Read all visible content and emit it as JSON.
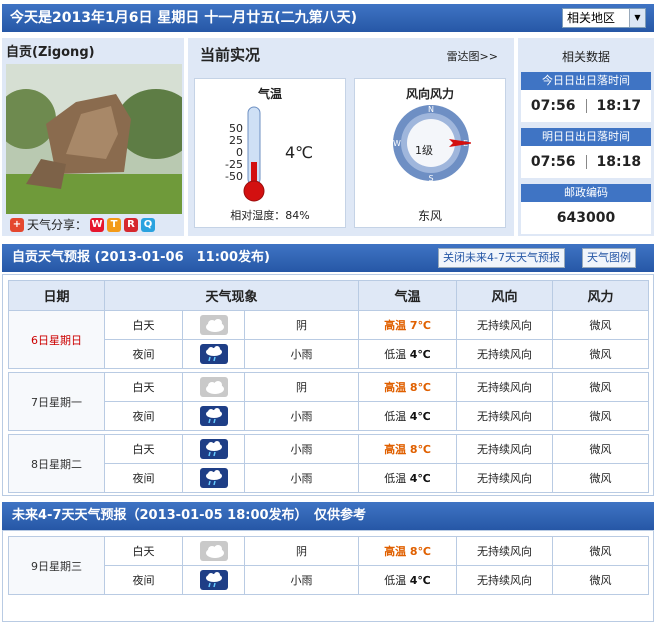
{
  "header": {
    "title": "今天是2013年1月6日 星期日 十一月廿五(二九第八天)",
    "region_select": "相关地区"
  },
  "city": {
    "name": "自贡(Zigong)",
    "share_label": "天气分享："
  },
  "current": {
    "title": "当前实况",
    "radar_link": "雷达图>>",
    "temp_box_title": "气温",
    "scale": [
      "50",
      "25",
      "0",
      "-25",
      "-50"
    ],
    "temp": "4℃",
    "temp_level_pct": 27,
    "humidity": "相对湿度：84%",
    "wind_box_title": "风向风力",
    "wind_level": "1级",
    "wind_dir": "东风",
    "compass": {
      "n": "N",
      "e": "E",
      "s": "S",
      "w": "W"
    }
  },
  "related": {
    "title": "相关数据",
    "today_label": "今日日出日落时间",
    "today_sunrise": "07:56",
    "today_sunset": "18:17",
    "tomorrow_label": "明日日出日落时间",
    "tomorrow_sunrise": "07:56",
    "tomorrow_sunset": "18:18",
    "postal_label": "邮政编码",
    "postal_code": "643000"
  },
  "forecast": {
    "title": "自贡天气预报 (2013-01-06　11:00发布)",
    "close_btn": "关闭未来4-7天天气预报",
    "legend_btn": "天气图例",
    "headers": [
      "日期",
      "天气现象",
      "气温",
      "风向",
      "风力"
    ],
    "days": [
      {
        "date": "6日星期日",
        "rows": [
          {
            "period": "白天",
            "icon": "cloudy-icon",
            "weather": "阴",
            "temp_label": "高温",
            "temp": "7℃",
            "wind_dir": "无持续风向",
            "wind_force": "微风"
          },
          {
            "period": "夜间",
            "icon": "light-rain-icon",
            "weather": "小雨",
            "temp_label": "低温",
            "temp": "4℃",
            "wind_dir": "无持续风向",
            "wind_force": "微风"
          }
        ]
      },
      {
        "date": "7日星期一",
        "rows": [
          {
            "period": "白天",
            "icon": "cloudy-icon",
            "weather": "阴",
            "temp_label": "高温",
            "temp": "8℃",
            "wind_dir": "无持续风向",
            "wind_force": "微风"
          },
          {
            "period": "夜间",
            "icon": "light-rain-icon",
            "weather": "小雨",
            "temp_label": "低温",
            "temp": "4℃",
            "wind_dir": "无持续风向",
            "wind_force": "微风"
          }
        ]
      },
      {
        "date": "8日星期二",
        "rows": [
          {
            "period": "白天",
            "icon": "light-rain-icon",
            "weather": "小雨",
            "temp_label": "高温",
            "temp": "8℃",
            "wind_dir": "无持续风向",
            "wind_force": "微风"
          },
          {
            "period": "夜间",
            "icon": "light-rain-icon",
            "weather": "小雨",
            "temp_label": "低温",
            "temp": "4℃",
            "wind_dir": "无持续风向",
            "wind_force": "微风"
          }
        ]
      }
    ]
  },
  "future": {
    "title": "未来4-7天天气预报（2013-01-05 18:00发布）　仅供参考",
    "days": [
      {
        "date": "9日星期三",
        "rows": [
          {
            "period": "白天",
            "icon": "cloudy-icon",
            "weather": "阴",
            "temp_label": "高温",
            "temp": "8℃",
            "wind_dir": "无持续风向",
            "wind_force": "微风"
          },
          {
            "period": "夜间",
            "icon": "light-rain-icon",
            "weather": "小雨",
            "temp_label": "低温",
            "temp": "4℃",
            "wind_dir": "无持续风向",
            "wind_force": "微风"
          }
        ]
      }
    ]
  }
}
